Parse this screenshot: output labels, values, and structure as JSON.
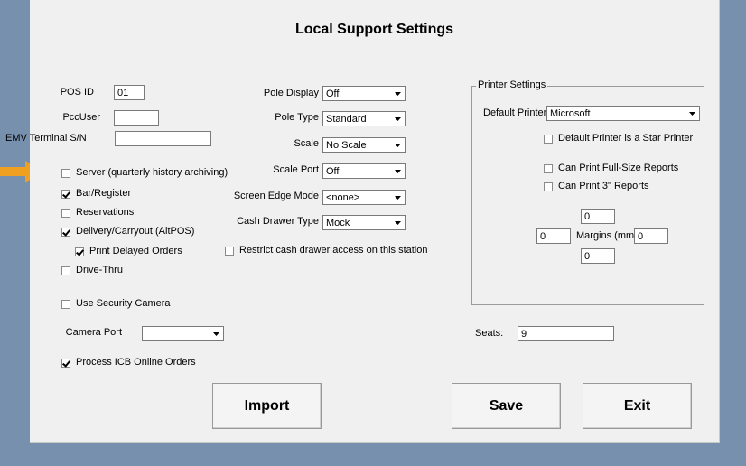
{
  "title": "Local Support Settings",
  "accent_arrow_color": "#f0a020",
  "fields": {
    "pos_id_label": "POS ID",
    "pos_id_value": "01",
    "pccuser_label": "PccUser",
    "pccuser_value": "",
    "emv_label": "EMV Terminal S/N",
    "emv_value": ""
  },
  "checks": {
    "server": "Server (quarterly history archiving)",
    "bar": "Bar/Register",
    "reservations": "Reservations",
    "delivery": "Delivery/Carryout (AltPOS)",
    "print_delayed": "Print Delayed Orders",
    "drive_thru": "Drive-Thru",
    "security_camera": "Use Security Camera",
    "process_icb": "Process ICB Online Orders",
    "restrict_drawer": "Restrict cash drawer access on this station"
  },
  "camera_port_label": "Camera Port",
  "camera_port_value": "",
  "middle": {
    "pole_display_label": "Pole Display",
    "pole_display_value": "Off",
    "pole_type_label": "Pole Type",
    "pole_type_value": "Standard",
    "scale_label": "Scale",
    "scale_value": "No Scale",
    "scale_port_label": "Scale Port",
    "scale_port_value": "Off",
    "screen_edge_label": "Screen Edge Mode",
    "screen_edge_value": "<none>",
    "cash_drawer_label": "Cash Drawer Type",
    "cash_drawer_value": "Mock"
  },
  "printer": {
    "group_label": "Printer Settings",
    "default_printer_label": "Default Printer",
    "default_printer_value": "Microsoft",
    "star_printer": "Default Printer is a Star Printer",
    "full_size": "Can Print Full-Size Reports",
    "three_inch": "Can Print 3\" Reports",
    "margins_label": "Margins (mm)",
    "margin_top": "0",
    "margin_left": "0",
    "margin_right": "0",
    "margin_bottom": "0"
  },
  "seats_label": "Seats:",
  "seats_value": "9",
  "buttons": {
    "import": "Import",
    "save": "Save",
    "exit": "Exit"
  }
}
